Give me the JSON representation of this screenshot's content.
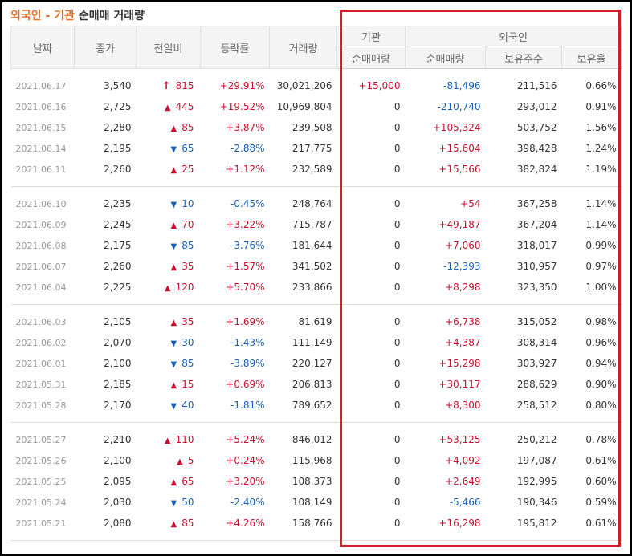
{
  "title": {
    "part1": "외국인",
    "sep": " - ",
    "part2": "기관",
    "part3": " 순매매 거래량"
  },
  "headers": {
    "date": "날짜",
    "close": "종가",
    "change": "전일비",
    "rate": "등락률",
    "volume": "거래량",
    "institution": "기관",
    "foreign": "외국인",
    "inst_net": "순매매량",
    "foreign_net": "순매매량",
    "holdings": "보유주수",
    "ratio": "보유율"
  },
  "colors": {
    "up": "#c8102e",
    "down": "#1a5fb4",
    "highlight": "#d41d2a",
    "title_accent": "#e8702a"
  },
  "rows": [
    {
      "date": "2021.06.17",
      "close": "3,540",
      "dir": "limit-up",
      "change": "815",
      "rate": "+29.91%",
      "volume": "30,021,206",
      "inst": "+15,000",
      "foreign": "-81,496",
      "holdings": "211,516",
      "ratio": "0.66%"
    },
    {
      "date": "2021.06.16",
      "close": "2,725",
      "dir": "up",
      "change": "445",
      "rate": "+19.52%",
      "volume": "10,969,804",
      "inst": "0",
      "foreign": "-210,740",
      "holdings": "293,012",
      "ratio": "0.91%"
    },
    {
      "date": "2021.06.15",
      "close": "2,280",
      "dir": "up",
      "change": "85",
      "rate": "+3.87%",
      "volume": "239,508",
      "inst": "0",
      "foreign": "+105,324",
      "holdings": "503,752",
      "ratio": "1.56%"
    },
    {
      "date": "2021.06.14",
      "close": "2,195",
      "dir": "down",
      "change": "65",
      "rate": "-2.88%",
      "volume": "217,775",
      "inst": "0",
      "foreign": "+15,604",
      "holdings": "398,428",
      "ratio": "1.24%"
    },
    {
      "date": "2021.06.11",
      "close": "2,260",
      "dir": "up",
      "change": "25",
      "rate": "+1.12%",
      "volume": "232,589",
      "inst": "0",
      "foreign": "+15,566",
      "holdings": "382,824",
      "ratio": "1.19%"
    },
    {
      "date": "2021.06.10",
      "close": "2,235",
      "dir": "down",
      "change": "10",
      "rate": "-0.45%",
      "volume": "248,764",
      "inst": "0",
      "foreign": "+54",
      "holdings": "367,258",
      "ratio": "1.14%"
    },
    {
      "date": "2021.06.09",
      "close": "2,245",
      "dir": "up",
      "change": "70",
      "rate": "+3.22%",
      "volume": "715,787",
      "inst": "0",
      "foreign": "+49,187",
      "holdings": "367,204",
      "ratio": "1.14%"
    },
    {
      "date": "2021.06.08",
      "close": "2,175",
      "dir": "down",
      "change": "85",
      "rate": "-3.76%",
      "volume": "181,644",
      "inst": "0",
      "foreign": "+7,060",
      "holdings": "318,017",
      "ratio": "0.99%"
    },
    {
      "date": "2021.06.07",
      "close": "2,260",
      "dir": "up",
      "change": "35",
      "rate": "+1.57%",
      "volume": "341,502",
      "inst": "0",
      "foreign": "-12,393",
      "holdings": "310,957",
      "ratio": "0.97%"
    },
    {
      "date": "2021.06.04",
      "close": "2,225",
      "dir": "up",
      "change": "120",
      "rate": "+5.70%",
      "volume": "233,866",
      "inst": "0",
      "foreign": "+8,298",
      "holdings": "323,350",
      "ratio": "1.00%"
    },
    {
      "date": "2021.06.03",
      "close": "2,105",
      "dir": "up",
      "change": "35",
      "rate": "+1.69%",
      "volume": "81,619",
      "inst": "0",
      "foreign": "+6,738",
      "holdings": "315,052",
      "ratio": "0.98%"
    },
    {
      "date": "2021.06.02",
      "close": "2,070",
      "dir": "down",
      "change": "30",
      "rate": "-1.43%",
      "volume": "111,149",
      "inst": "0",
      "foreign": "+4,387",
      "holdings": "308,314",
      "ratio": "0.96%"
    },
    {
      "date": "2021.06.01",
      "close": "2,100",
      "dir": "down",
      "change": "85",
      "rate": "-3.89%",
      "volume": "220,127",
      "inst": "0",
      "foreign": "+15,298",
      "holdings": "303,927",
      "ratio": "0.94%"
    },
    {
      "date": "2021.05.31",
      "close": "2,185",
      "dir": "up",
      "change": "15",
      "rate": "+0.69%",
      "volume": "206,813",
      "inst": "0",
      "foreign": "+30,117",
      "holdings": "288,629",
      "ratio": "0.90%"
    },
    {
      "date": "2021.05.28",
      "close": "2,170",
      "dir": "down",
      "change": "40",
      "rate": "-1.81%",
      "volume": "789,652",
      "inst": "0",
      "foreign": "+8,300",
      "holdings": "258,512",
      "ratio": "0.80%"
    },
    {
      "date": "2021.05.27",
      "close": "2,210",
      "dir": "up",
      "change": "110",
      "rate": "+5.24%",
      "volume": "846,012",
      "inst": "0",
      "foreign": "+53,125",
      "holdings": "250,212",
      "ratio": "0.78%"
    },
    {
      "date": "2021.05.26",
      "close": "2,100",
      "dir": "up",
      "change": "5",
      "rate": "+0.24%",
      "volume": "115,968",
      "inst": "0",
      "foreign": "+4,092",
      "holdings": "197,087",
      "ratio": "0.61%"
    },
    {
      "date": "2021.05.25",
      "close": "2,095",
      "dir": "up",
      "change": "65",
      "rate": "+3.20%",
      "volume": "108,373",
      "inst": "0",
      "foreign": "+2,649",
      "holdings": "192,995",
      "ratio": "0.60%"
    },
    {
      "date": "2021.05.24",
      "close": "2,030",
      "dir": "down",
      "change": "50",
      "rate": "-2.40%",
      "volume": "108,149",
      "inst": "0",
      "foreign": "-5,466",
      "holdings": "190,346",
      "ratio": "0.59%"
    },
    {
      "date": "2021.05.21",
      "close": "2,080",
      "dir": "up",
      "change": "85",
      "rate": "+4.26%",
      "volume": "158,766",
      "inst": "0",
      "foreign": "+16,298",
      "holdings": "195,812",
      "ratio": "0.61%"
    }
  ]
}
